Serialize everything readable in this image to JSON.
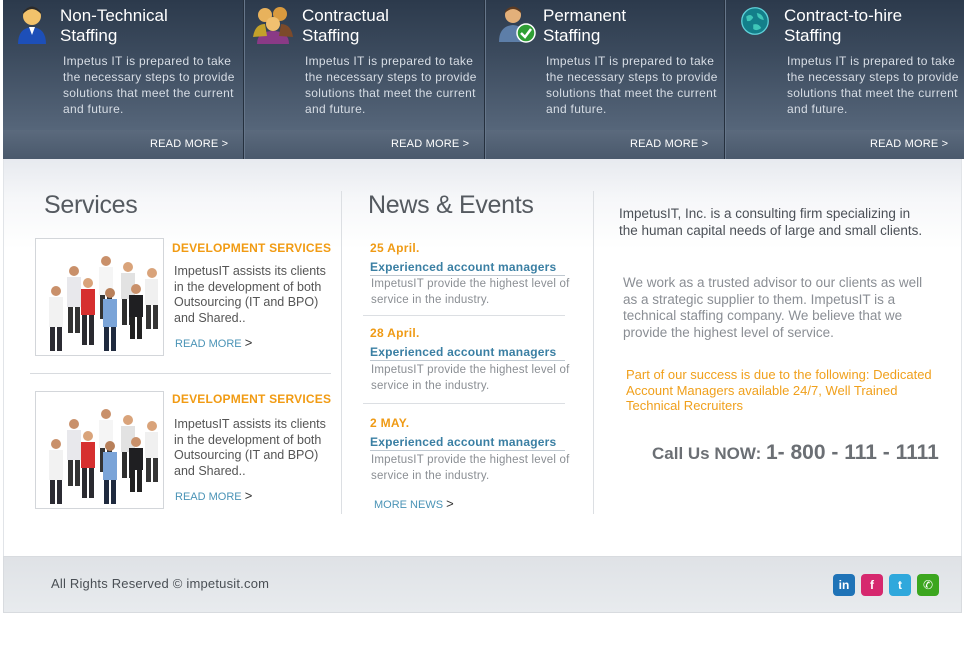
{
  "banner": {
    "items": [
      {
        "title": "Non-Technical\nStaffing",
        "text": "Impetus IT is prepared to take the necessary steps to provide solutions that meet the current and future.",
        "read_more": "READ MORE >",
        "icon": "person-icon"
      },
      {
        "title": "Contractual\nStaffing",
        "text": "Impetus IT is prepared to take the necessary steps to provide solutions that meet the current and future.",
        "read_more": "READ MORE >",
        "icon": "group-icon"
      },
      {
        "title": "Permanent\nStaffing",
        "text": "Impetus IT is prepared to take the necessary steps to provide solutions that meet the current and future.",
        "read_more": "READ MORE >",
        "icon": "user-check-icon"
      },
      {
        "title": "Contract-to-hire\nStaffing",
        "text": "Impetus IT is prepared to take the necessary steps to provide solutions that meet the current and future.",
        "read_more": "READ MORE >",
        "icon": "globe-icon"
      }
    ]
  },
  "services": {
    "heading": "Services",
    "items": [
      {
        "title": "DEVELOPMENT SERVICES",
        "text": "ImpetusIT assists its clients in the development of both Outsourcing (IT and BPO) and Shared..",
        "read_more": "READ MORE",
        "arrow": ">"
      },
      {
        "title": "DEVELOPMENT SERVICES",
        "text": "ImpetusIT assists its clients in the development of both Outsourcing (IT and BPO) and Shared..",
        "read_more": "READ MORE",
        "arrow": ">"
      }
    ]
  },
  "news": {
    "heading": "News & Events",
    "items": [
      {
        "date": "25 April.",
        "headline": "Experienced account managers",
        "text": "ImpetusIT provide the highest level of service in the industry."
      },
      {
        "date": "28 April.",
        "headline": "Experienced account managers",
        "text": "ImpetusIT provide the highest level of service in the industry."
      },
      {
        "date": "2 MAY.",
        "headline": "Experienced account managers",
        "text": "ImpetusIT provide the highest level of service in the industry."
      }
    ],
    "more_news": "MORE NEWS",
    "more_arrow": ">"
  },
  "about": {
    "intro": "ImpetusIT, Inc. is a consulting firm specializing in the human capital needs of large and small clients.",
    "advisor": "We work as a trusted advisor to our clients as well as a strategic supplier to them.  ImpetusIT is a technical staffing company. We believe that we provide the highest level of service.",
    "success": "Part of our success is due to the  following: Dedicated Account Managers available 24/7, Well Trained Technical Recruiters",
    "call_label": "Call Us NOW:",
    "call_number": "1- 800 - 111 - 1111"
  },
  "footer": {
    "copyright": "All Rights Reserved © impetusit.com",
    "social": [
      {
        "name": "linkedin-icon",
        "glyph": "in",
        "color": "#1f73b7"
      },
      {
        "name": "facebook-icon",
        "glyph": "f",
        "color": "#d6286e"
      },
      {
        "name": "twitter-icon",
        "glyph": "t",
        "color": "#2fa8dc"
      },
      {
        "name": "chat-icon",
        "glyph": "✆",
        "color": "#3ca61f"
      }
    ]
  },
  "colors": {
    "accent_orange": "#ef9a14",
    "link_blue": "#3a7fa3",
    "banner_dark": "#2c3a4c"
  }
}
